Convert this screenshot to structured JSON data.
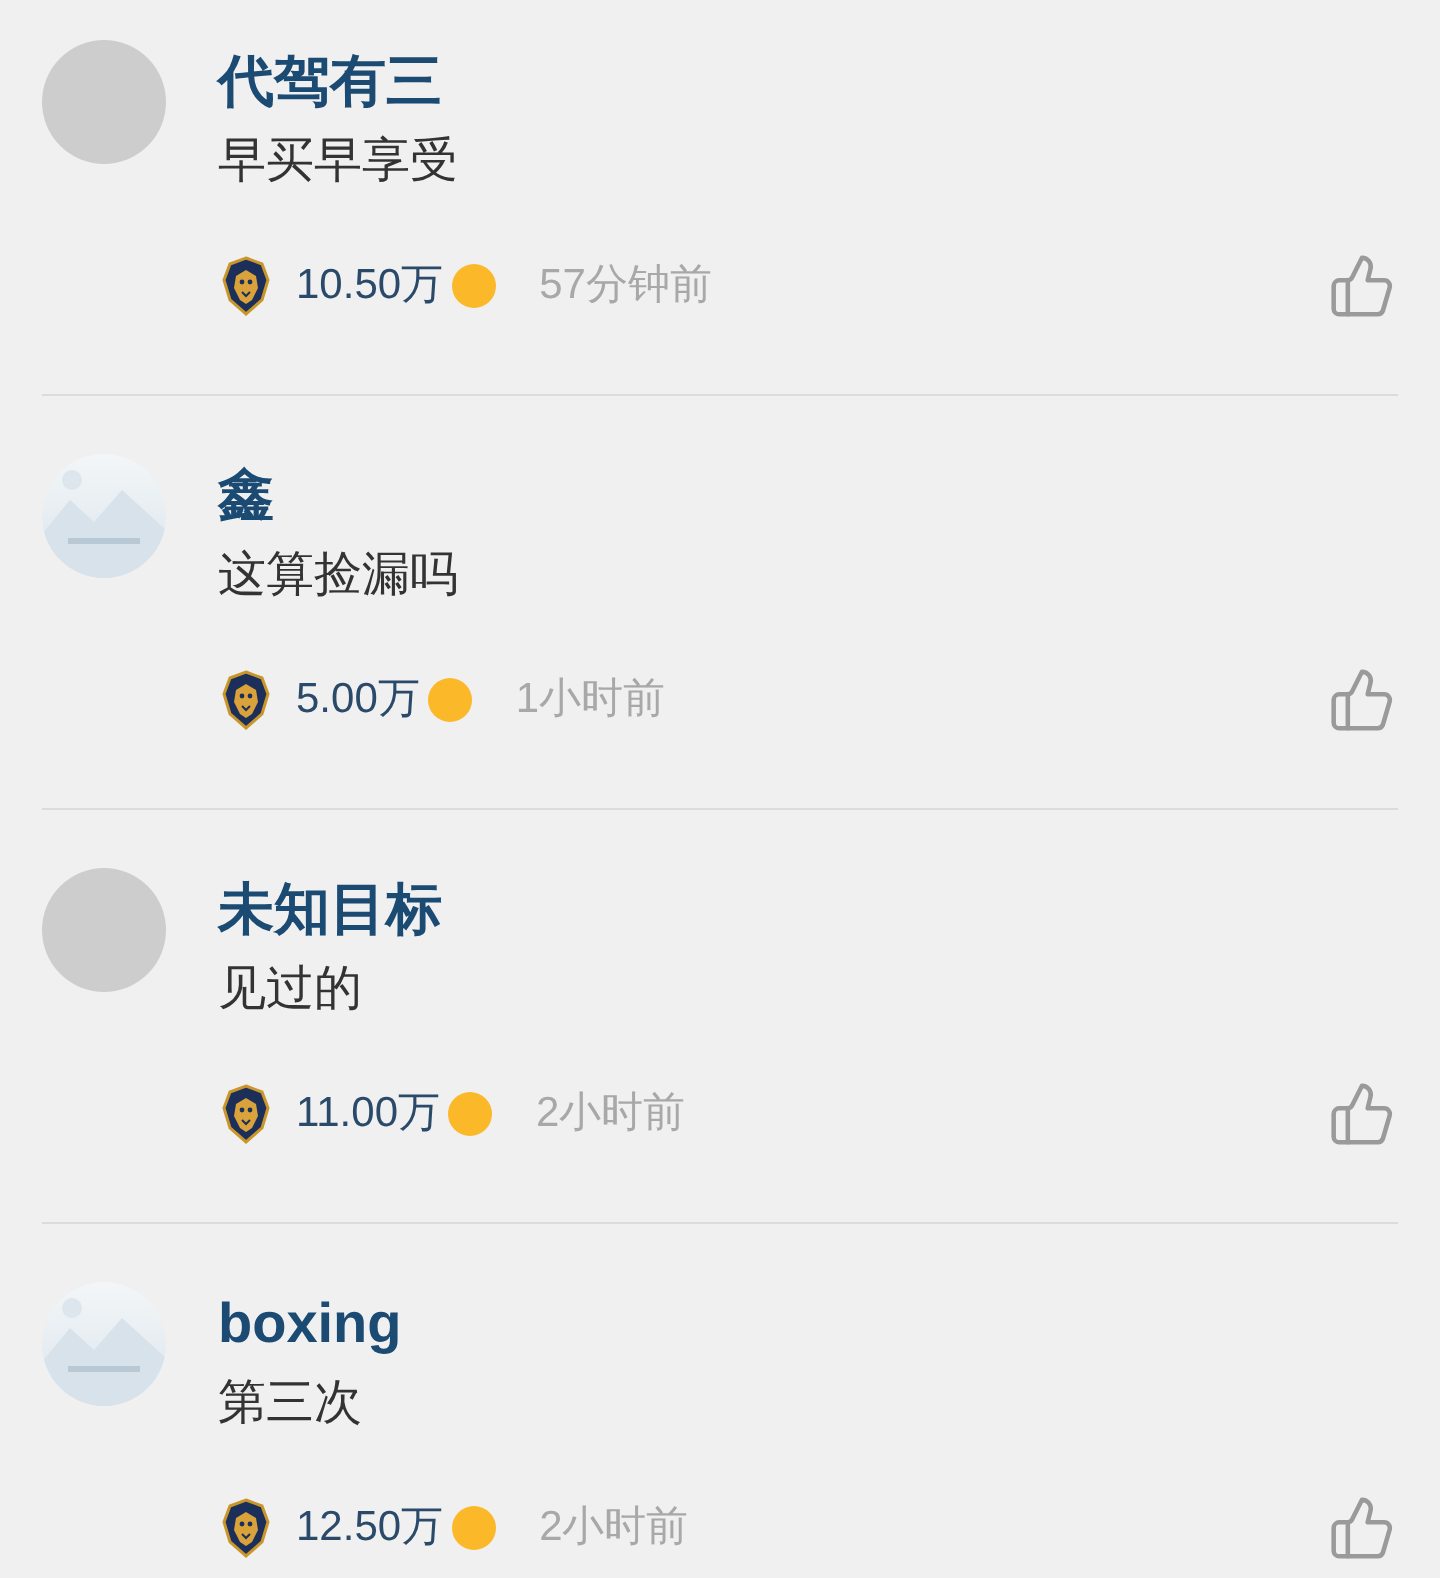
{
  "comments": [
    {
      "avatar": {
        "kind": "blank"
      },
      "name": "代驾有三",
      "text": "早买早享受",
      "coins": "10.50万",
      "time": "57分钟前"
    },
    {
      "avatar": {
        "kind": "placeholder"
      },
      "name": "鑫",
      "text": "这算捡漏吗",
      "coins": "5.00万",
      "time": "1小时前"
    },
    {
      "avatar": {
        "kind": "blank"
      },
      "name": "未知目标",
      "text": "见过的",
      "coins": "11.00万",
      "time": "2小时前"
    },
    {
      "avatar": {
        "kind": "placeholder"
      },
      "name": "boxing",
      "text": "第三次",
      "coins": "12.50万",
      "time": "2小时前"
    }
  ]
}
